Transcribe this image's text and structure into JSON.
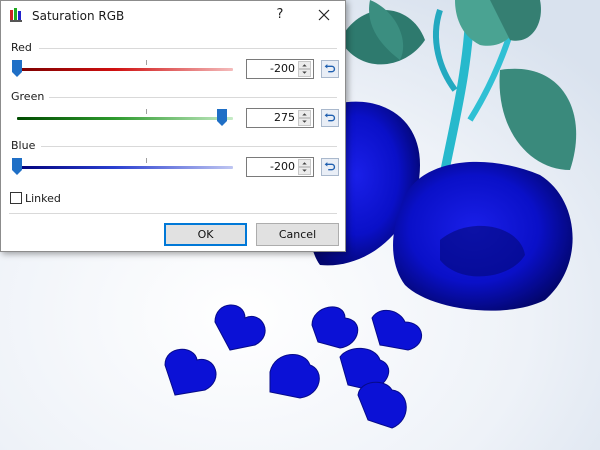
{
  "window": {
    "title": "Saturation RGB",
    "help_glyph": "?",
    "icon": "rgb-bars-icon"
  },
  "channels": [
    {
      "label": "Red",
      "value": "-200",
      "level": 0.0,
      "color": "#d01010"
    },
    {
      "label": "Green",
      "value": "275",
      "level": 0.95,
      "color": "#2d9a2d"
    },
    {
      "label": "Blue",
      "value": "-200",
      "level": 0.0,
      "color": "#2a3fd0"
    }
  ],
  "linked": {
    "label": "Linked",
    "checked": false
  },
  "buttons": {
    "ok": "OK",
    "cancel": "Cancel"
  },
  "colors": {
    "accent": "#0078d7",
    "thumb": "#1f6fc6",
    "roses": "#0a12d8"
  }
}
